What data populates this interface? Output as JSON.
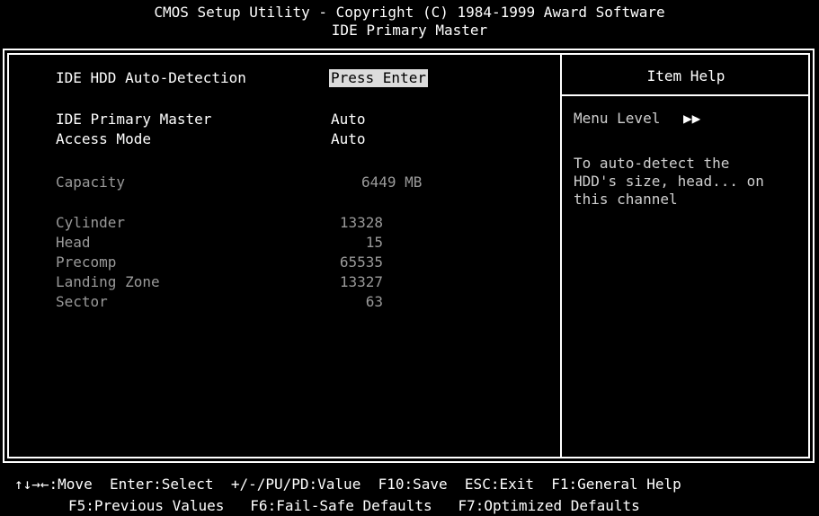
{
  "header": {
    "line1": "CMOS Setup Utility - Copyright (C) 1984-1999 Award Software",
    "line2": "IDE Primary Master"
  },
  "settings": {
    "auto_detect": {
      "label": "IDE HDD Auto-Detection",
      "value": "Press Enter"
    },
    "primary_master": {
      "label": "IDE Primary Master",
      "value": "Auto"
    },
    "access_mode": {
      "label": "Access Mode",
      "value": "Auto"
    },
    "capacity": {
      "label": "Capacity",
      "value": "6449 MB"
    },
    "cylinder": {
      "label": "Cylinder",
      "value": "13328"
    },
    "head": {
      "label": "Head",
      "value": "15"
    },
    "precomp": {
      "label": "Precomp",
      "value": "65535"
    },
    "landing_zone": {
      "label": "Landing Zone",
      "value": "13327"
    },
    "sector": {
      "label": "Sector",
      "value": "63"
    }
  },
  "help": {
    "title": "Item Help",
    "menu_level": "Menu Level",
    "menu_level_glyph": "▶▶",
    "lines": [
      "To auto-detect the",
      "HDD's size, head... on",
      "this channel"
    ]
  },
  "footer": {
    "row1": [
      "↑↓→←:Move",
      "Enter:Select",
      "+/-/PU/PD:Value",
      "F10:Save",
      "ESC:Exit",
      "F1:General Help"
    ],
    "row2": [
      "F5:Previous Values",
      "F6:Fail-Safe Defaults",
      "F7:Optimized Defaults"
    ]
  }
}
